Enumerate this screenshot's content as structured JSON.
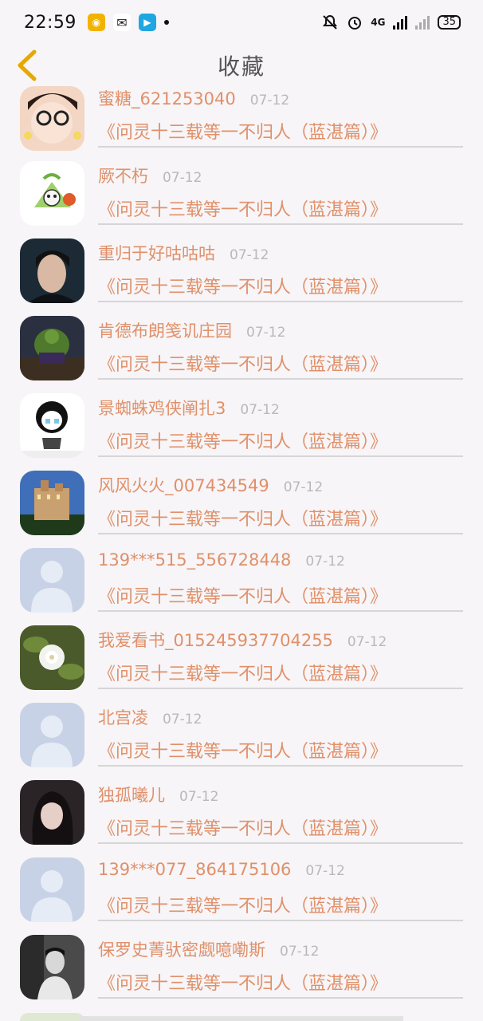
{
  "status": {
    "time": "22:59",
    "battery": "35",
    "network": "4G"
  },
  "header": {
    "title": "收藏"
  },
  "items": [
    {
      "username": "蜜糖_621253040",
      "date": "07-12",
      "book": "《问灵十三载等一不归人（蓝湛篇）》",
      "avatar": "girl-glasses"
    },
    {
      "username": "厥不朽",
      "date": "07-12",
      "book": "《问灵十三载等一不归人（蓝湛篇）》",
      "avatar": "cartoon-zongzi"
    },
    {
      "username": "重归于好咕咕咕",
      "date": "07-12",
      "book": "《问灵十三载等一不归人（蓝湛篇）》",
      "avatar": "man-portrait"
    },
    {
      "username": "肯德布朗笺讥庄园",
      "date": "07-12",
      "book": "《问灵十三载等一不归人（蓝湛篇）》",
      "avatar": "hulk"
    },
    {
      "username": "景蜘蛛鸡侠阐扎3",
      "date": "07-12",
      "book": "《问灵十三载等一不归人（蓝湛篇）》",
      "avatar": "meme-crying"
    },
    {
      "username": "风风火火_007434549",
      "date": "07-12",
      "book": "《问灵十三载等一不归人（蓝湛篇）》",
      "avatar": "castle"
    },
    {
      "username": "139***515_556728448",
      "date": "07-12",
      "book": "《问灵十三载等一不归人（蓝湛篇）》",
      "avatar": "default"
    },
    {
      "username": "我爱看书_015245937704255",
      "date": "07-12",
      "book": "《问灵十三载等一不归人（蓝湛篇）》",
      "avatar": "white-flower"
    },
    {
      "username": "北宫凌",
      "date": "07-12",
      "book": "《问灵十三载等一不归人（蓝湛篇）》",
      "avatar": "default"
    },
    {
      "username": "独孤曦儿",
      "date": "07-12",
      "book": "《问灵十三载等一不归人（蓝湛篇）》",
      "avatar": "girl-dark"
    },
    {
      "username": "139***077_864175106",
      "date": "07-12",
      "book": "《问灵十三载等一不归人（蓝湛篇）》",
      "avatar": "default"
    },
    {
      "username": "保罗史菁驮密觑噫嘞斯",
      "date": "07-12",
      "book": "《问灵十三载等一不归人（蓝湛篇）》",
      "avatar": "man-bw"
    }
  ],
  "colors": {
    "accent": "#e0906a",
    "date": "#b9b9b9",
    "back": "#e8a800"
  }
}
